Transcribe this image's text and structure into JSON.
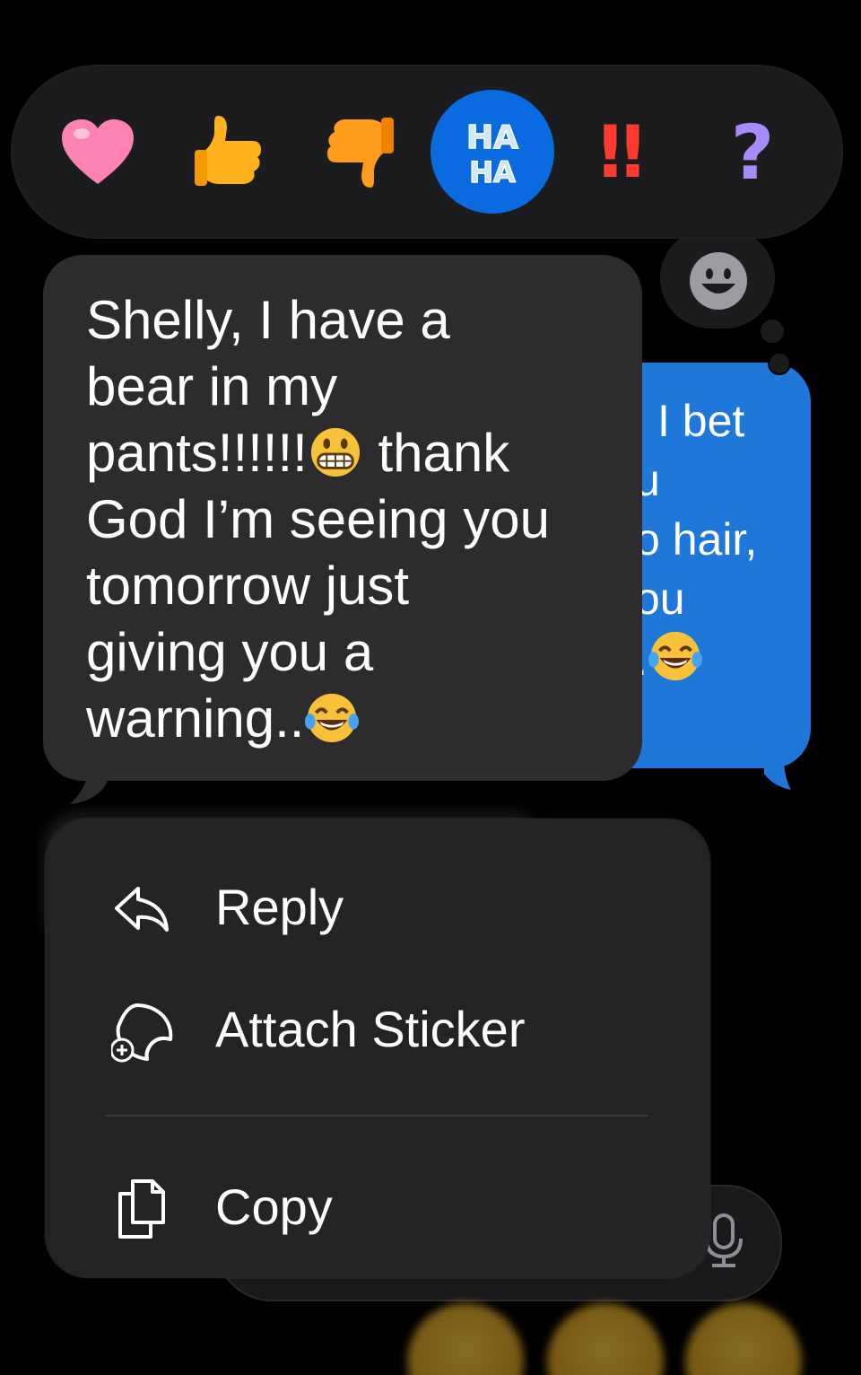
{
  "tapbacks": [
    {
      "name": "heart",
      "selected": false
    },
    {
      "name": "thumbs-up",
      "selected": false
    },
    {
      "name": "thumbs-down",
      "selected": false
    },
    {
      "name": "haha",
      "selected": true,
      "text_top": "HA",
      "text_bottom": "HA"
    },
    {
      "name": "exclamation",
      "selected": false,
      "text": "‼"
    },
    {
      "name": "question",
      "selected": false,
      "text": "?"
    }
  ],
  "emoji_picker_icon": "smiley-icon",
  "received_message": {
    "line1": "Shelly, I have a",
    "line2": "bear in my",
    "line3a": "pants!!!!!!",
    "line3b": " thank",
    "line4": "God I’m seeing you",
    "line5": "tomorrow just",
    "line6": "giving you a",
    "line7": "warning..",
    "emojis": [
      "grimacing-face",
      "face-with-tears-of-joy"
    ]
  },
  "sent_message_visible_fragments": {
    "line1": "l I bet",
    "line2": "u",
    "line3": "o hair,",
    "line4": "ou",
    "line5": ".",
    "emoji": "face-with-tears-of-joy"
  },
  "context_menu": {
    "reply": "Reply",
    "attach_sticker": "Attach Sticker",
    "copy": "Copy"
  },
  "colors": {
    "background": "#000000",
    "bubble_received": "#2c2c2e",
    "bubble_sent": "#1f77d9",
    "haha_selected": "#0a6ae0",
    "menu_bg": "#242426"
  }
}
